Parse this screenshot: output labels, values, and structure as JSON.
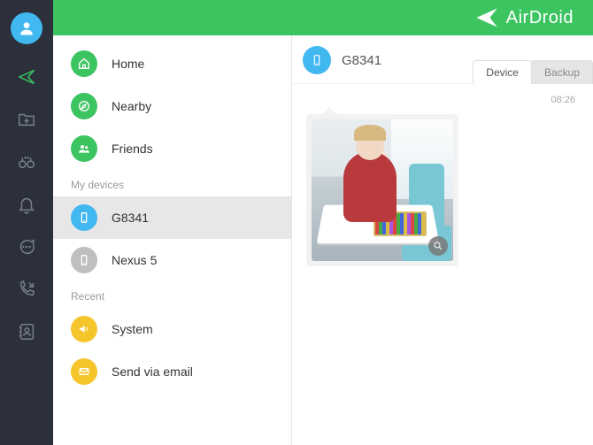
{
  "brand": {
    "name": "AirDroid"
  },
  "sidebar": {
    "primary": [
      {
        "label": "Home"
      },
      {
        "label": "Nearby"
      },
      {
        "label": "Friends"
      }
    ],
    "devices_label": "My devices",
    "devices": [
      {
        "label": "G8341",
        "selected": true
      },
      {
        "label": "Nexus 5",
        "selected": false
      }
    ],
    "recent_label": "Recent",
    "recent": [
      {
        "label": "System"
      },
      {
        "label": "Send via email"
      }
    ]
  },
  "content": {
    "device_title": "G8341",
    "tabs": {
      "device": "Device",
      "backup": "Backup",
      "active": "device"
    },
    "timestamp": "08:26"
  }
}
